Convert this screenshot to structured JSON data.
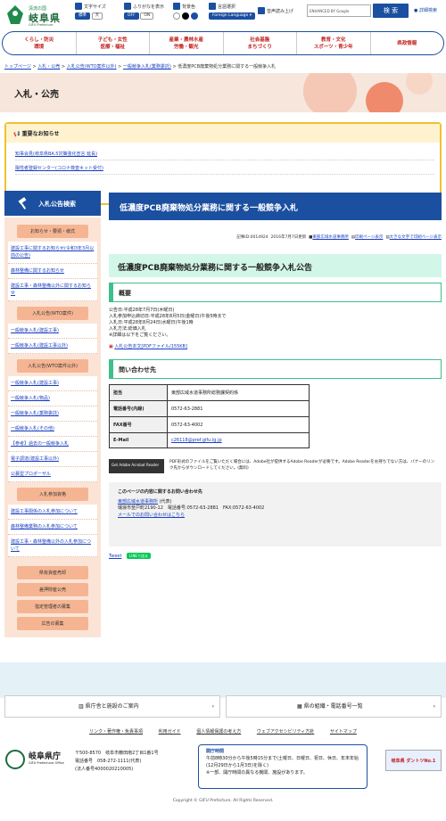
{
  "header": {
    "logo_small": "清流の国",
    "logo_big": "岐阜県",
    "logo_en": "GIFU Prefecture",
    "font_size_label": "文字サイズ",
    "font_std": "標準",
    "font_large": "大",
    "furigana_label": "ふりがなを表示",
    "furigana_off": "OFF",
    "furigana_on": "ON",
    "bg_label": "背景色",
    "lang_label": "言語選択",
    "lang_button": "Foreign Language ▾",
    "voice_label": "音声読み上げ",
    "search_placeholder": "ENHANCED BY Google",
    "search_button": "検 索",
    "detail_search": "詳細検索"
  },
  "gnav": [
    {
      "line1": "くらし・防災",
      "line2": "環境"
    },
    {
      "line1": "子ども・女性",
      "line2": "医療・福祉"
    },
    {
      "line1": "産業・農林水産",
      "line2": "労働・観光"
    },
    {
      "line1": "社会基盤",
      "line2": "まちづくり"
    },
    {
      "line1": "教育・文化",
      "line2": "スポーツ・青少年"
    },
    {
      "line1": "県政情報",
      "line2": ""
    }
  ],
  "breadcrumb": {
    "items": [
      "トップページ",
      "入札・公売",
      "入札公告(WTO案件以外)",
      "一般競争入札(業務委託)"
    ],
    "current": "低濃度PCB廃棄物処分業務に関する一般競争入札",
    "sep": ">"
  },
  "banner_title": "入札・公売",
  "notice": {
    "title": "重要なお知らせ",
    "items": [
      "知事会見(岐阜県BA.5対策強化宣言 延長)",
      "陽性者登録センター(コロナ検査キット受付)"
    ]
  },
  "sidebar": {
    "title": "入札公告検索",
    "groups": [
      {
        "label": "お知らせ・要領・様式",
        "links": [
          "建設工事に関するお知らせ(令和3年3月以前の公告)",
          "森林整備に関するお知らせ",
          "建設工事・森林整備以外に関するお知らせ"
        ]
      },
      {
        "label": "入札公告(WTO案件)",
        "links": [
          "一般競争入札(建設工事)",
          "一般競争入札(建設工事以外)"
        ]
      },
      {
        "label": "入札公告(WTO案件以外)",
        "links": [
          "一般競争入札(建設工事)",
          "一般競争入札(物品)",
          "一般競争入札(業務委託)",
          "一般競争入札(その他)",
          "【参考】過去の一般競争入札",
          "電子調達(建設工事以外)",
          "公募型プロポーザル"
        ]
      },
      {
        "label": "入札参加資格",
        "links": [
          "建設工事関係の入札参加について",
          "森林整備業務の入札参加について",
          "建設工事・森林整備以外の入札参加について"
        ]
      }
    ],
    "buttons": [
      "県有資産売却",
      "差押財産公売",
      "指定管理者の募集",
      "広告の募集"
    ]
  },
  "main": {
    "title": "低濃度PCB廃棄物処分業務に関する一般競争入札",
    "record_id": "記事ID:0014924",
    "updated": "2016年7月7日更新",
    "dept_link": "東部広域水道事務所",
    "print_link": "印刷ページ表示",
    "large_print_link": "大きな文字で印刷ページ表示",
    "h2": "低濃度PCB廃棄物処分業務に関する一般競争入札公告",
    "h3_overview": "概要",
    "overview_lines": [
      "公告日:平成28年7月7日(木曜日)",
      "入札参加申込締切日:平成28年8月5日(金曜日)午後5時まで",
      "入札日:平成28年8月24日(水曜日)午後1時",
      "入札方法:総価入札",
      "※詳細は以下をご覧ください。"
    ],
    "pdf_link": "入札公告本文[PDFファイル/155KB]",
    "h3_contact": "問い合わせ先",
    "contact_table": [
      {
        "k": "担当",
        "v": "東部広域水道事務所総務課契約係"
      },
      {
        "k": "電話番号(内線)",
        "v": "0572-63-2881"
      },
      {
        "k": "FAX番号",
        "v": "0572-63-4002"
      },
      {
        "k": "E-Mail",
        "v": "c26118@pref.gifu.lg.jp"
      }
    ],
    "adobe_badge": "Get Adobe Acrobat Reader",
    "adobe_text": "PDF形式のファイルをご覧いただく場合には、Adobe社が提供するAdobe Readerが必要です。Adobe Readerをお持ちでない方は、バナーのリンク先からダウンロードしてください。(無料)",
    "inquiry_title": "このページの内容に関するお問い合わせ先",
    "inquiry_dept": "東部広域水道事務所",
    "inquiry_suffix": "(代表)",
    "inquiry_address": "瑞浪市釜戸町2190-12　電話番号:0572-63-2881　FAX:0572-63-4002",
    "inquiry_mail": "メールでのお問い合わせはこちら",
    "tweet": "Tweet",
    "line": "LINEで送る"
  },
  "footer": {
    "btn_left": "県庁舎と施設のご案内",
    "btn_right": "県の組織・電話番号一覧",
    "nav": [
      "リンク・著作権・免責事項",
      "利用ガイド",
      "個人情報保護の考え方",
      "ウェブアクセシビリティ方針",
      "サイトマップ"
    ],
    "office_name": "岐阜県庁",
    "office_en": "GIFU Prefectural Office",
    "address": "〒500-8570　岐阜市薮田南2丁目1番1号",
    "phone": "電話番号　058-272-1111(代表)",
    "corp_no": "(法人番号4000020210005)",
    "hours_title": "開庁時間",
    "hours_text": "午前8時30分から午後5時15分まで(土曜日、日曜日、祝日、休日、年末年始(12月29日から1月3日)を除く)",
    "hours_note": "※一部、開庁時間の異なる機関、施設があります。",
    "ad_text": "岐阜県 ダントツNo.1",
    "copyright": "Copyright © GIFU Prefecture. All Rights Reserved."
  }
}
